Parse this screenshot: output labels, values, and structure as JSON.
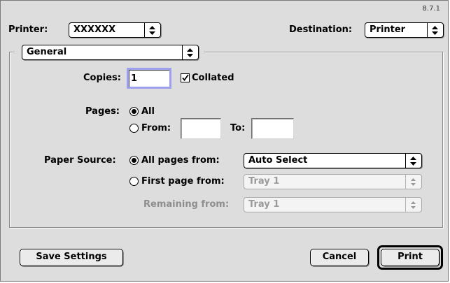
{
  "dialog": {
    "version": "8.7.1",
    "printer": {
      "label": "Printer:",
      "value": "XXXXXX"
    },
    "destination": {
      "label": "Destination:",
      "value": "Printer"
    },
    "panel": {
      "value": "General"
    },
    "copies": {
      "label": "Copies:",
      "value": "1",
      "collated_label": "Collated",
      "collated": true
    },
    "pages": {
      "label": "Pages:",
      "all_label": "All",
      "from_label": "From:",
      "to_label": "To:",
      "from_value": "",
      "to_value": "",
      "selected": "all"
    },
    "paper_source": {
      "label": "Paper Source:",
      "all_pages_label": "All pages from:",
      "all_pages_value": "Auto Select",
      "first_page_label": "First page from:",
      "first_page_value": "Tray 1",
      "remaining_label": "Remaining from:",
      "remaining_value": "Tray 1",
      "selected": "all_pages"
    },
    "buttons": {
      "save_settings": "Save Settings",
      "cancel": "Cancel",
      "print": "Print"
    }
  },
  "icons": {
    "popup_arrows": "up-down-arrows-icon",
    "checkmark": "checkmark-icon"
  },
  "colors": {
    "dialog_bg": "#dddddd",
    "focus_ring": "#9f9ff0",
    "disabled_text": "#8e8e8e"
  }
}
